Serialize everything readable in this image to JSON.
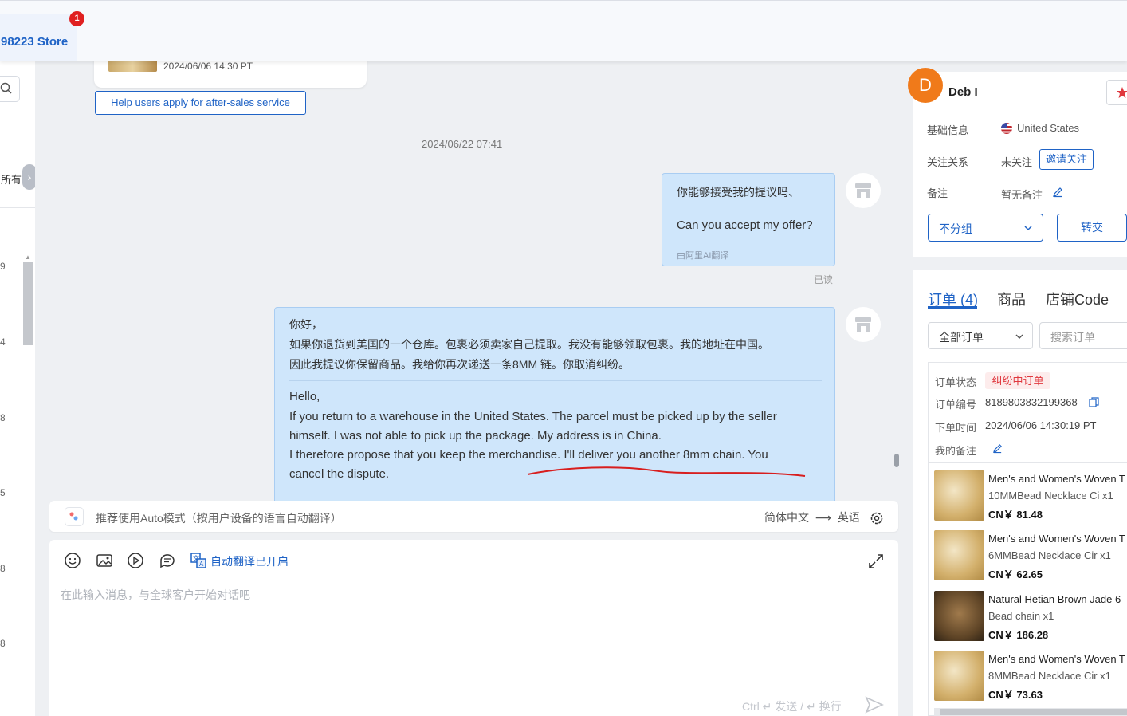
{
  "header": {
    "store_name": "98223 Store",
    "unread_badge": "1"
  },
  "left_strip": {
    "filter_label": "所有",
    "row_numbers": [
      "9",
      "4",
      "8",
      "5",
      "8",
      "8"
    ]
  },
  "chat": {
    "product_time": "2024/06/06 14:30 PT",
    "aftersales_button": "Help users apply for after-sales service",
    "date_divider": "2024/06/22 07:41",
    "message1": {
      "original": "你能够接受我的提议吗、",
      "translated": "Can you accept my offer?",
      "translated_by": "由阿里AI翻译",
      "read_status": "已读"
    },
    "message2": {
      "original_lines": [
        "你好，",
        "如果你退货到美国的一个仓库。包裹必须卖家自己提取。我没有能够领取包裹。我的地址在中国。",
        "因此我提议你保留商品。我给你再次递送一条8MM 链。你取消纠纷。"
      ],
      "translated_lines": [
        "Hello,",
        "If you return to a warehouse in the United States. The parcel must be picked up by the seller",
        "himself. I was not able to pick up the package. My address is in China.",
        "I therefore propose that you keep the merchandise. I'll deliver you another 8mm chain. You",
        "cancel the dispute."
      ]
    }
  },
  "translate_bar": {
    "hint": "推荐使用Auto模式（按用户设备的语言自动翻译）",
    "source_lang": "简体中文",
    "arrow": "⟶",
    "target_lang": "英语"
  },
  "composer": {
    "auto_translate": "自动翻译已开启",
    "placeholder": "在此输入消息，与全球客户开始对话吧",
    "send_hint": "Ctrl ↵ 发送 / ↵ 换行"
  },
  "customer": {
    "avatar_letter": "D",
    "name": "Deb I",
    "basic_info_label": "基础信息",
    "country": "United States",
    "follow_label": "关注关系",
    "follow_value": "未关注",
    "invite_button": "邀请关注",
    "note_label": "备注",
    "note_value": "暂无备注",
    "group_select": "不分组",
    "transfer_button": "转交"
  },
  "orders_panel": {
    "tabs": [
      "订单 (4)",
      "商品",
      "店铺Code"
    ],
    "filter": "全部订单",
    "search_placeholder": "搜索订单",
    "status_label": "订单状态",
    "status_value": "纠纷中订单",
    "order_no_label": "订单编号",
    "order_no_value": "8189803832199368",
    "order_time_label": "下单时间",
    "order_time_value": "2024/06/06 14:30:19 PT",
    "my_note_label": "我的备注",
    "items": [
      {
        "title": "Men's and Women's Woven T",
        "spec": "10MMBead Necklace Ci x1",
        "price": "CN￥ 81.48"
      },
      {
        "title": "Men's and Women's Woven T",
        "spec": "6MMBead Necklace Cir x1",
        "price": "CN￥ 62.65"
      },
      {
        "title": "Natural Hetian Brown Jade 6",
        "spec": "Bead chain x1",
        "price": "CN￥ 186.28"
      },
      {
        "title": "Men's and Women's Woven T",
        "spec": "8MMBead Necklace Cir x1",
        "price": "CN￥ 73.63"
      }
    ]
  },
  "colors": {
    "accent": "#1f63c6",
    "bubble": "#cfe6fb",
    "avatar": "#f07a1a",
    "alert": "#e02020"
  }
}
